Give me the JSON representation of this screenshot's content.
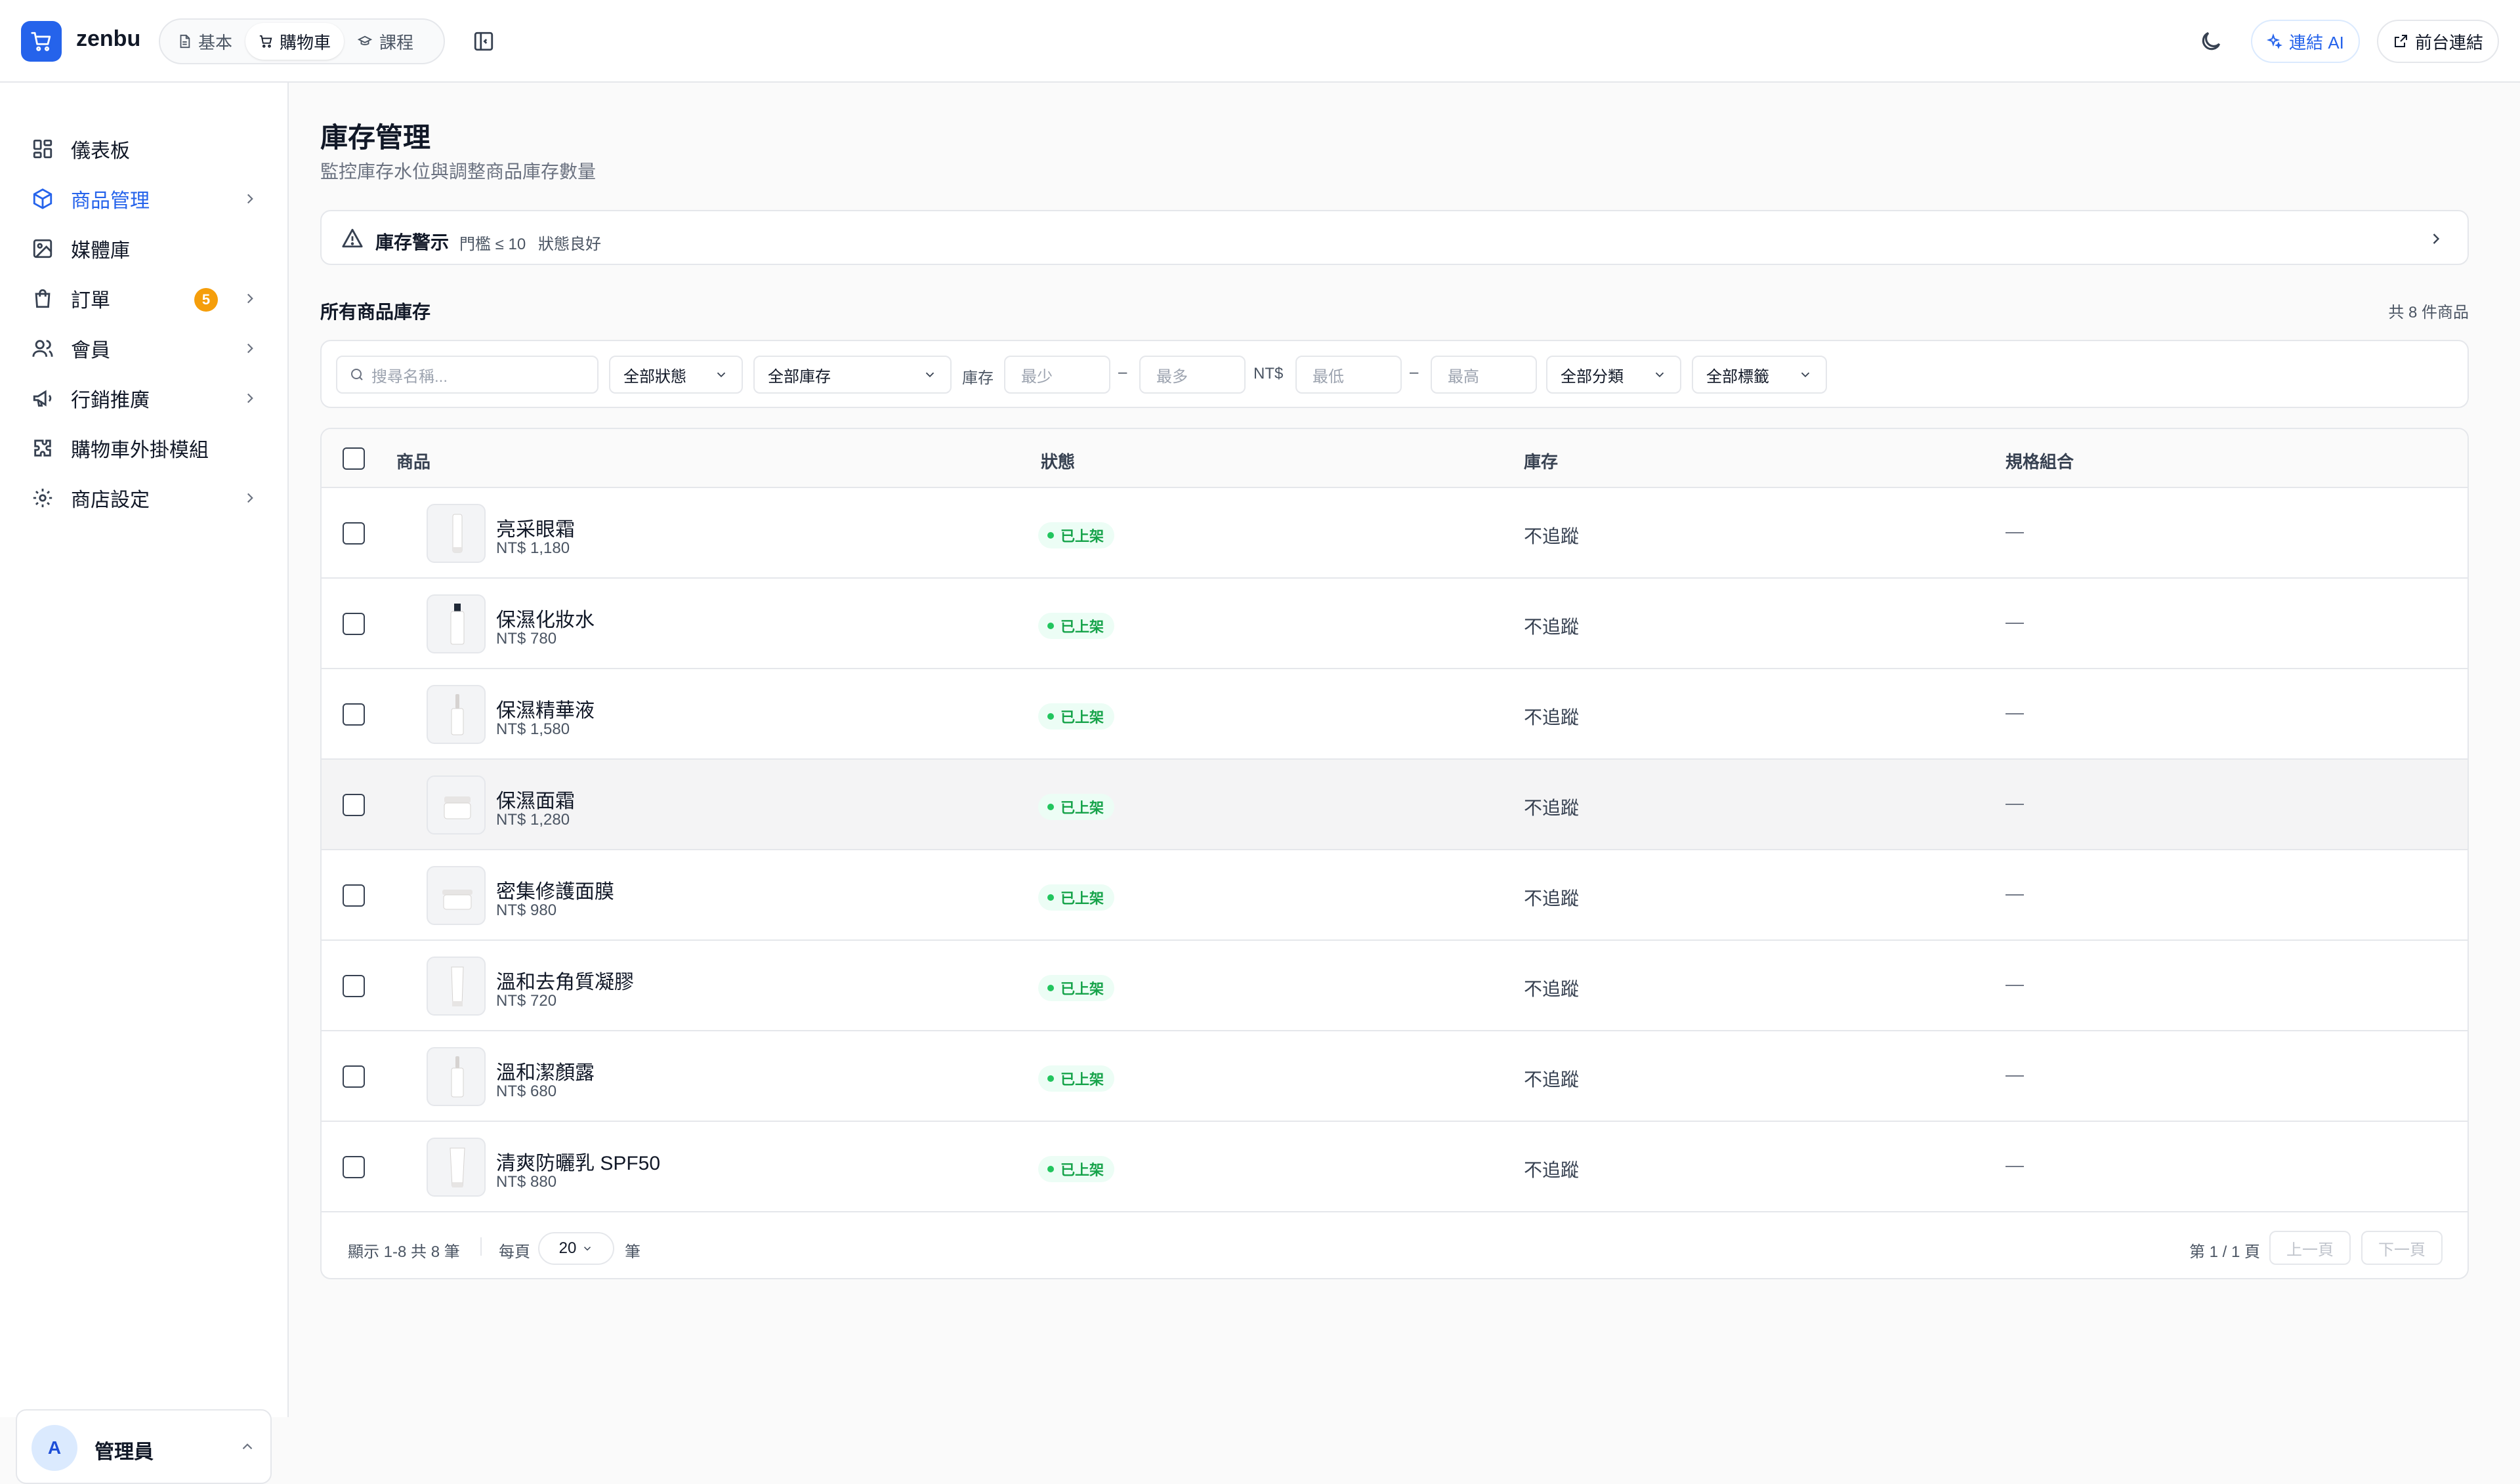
{
  "brand": {
    "name": "zenbu"
  },
  "mode_tabs": [
    {
      "label": "基本",
      "icon": "document-icon"
    },
    {
      "label": "購物車",
      "icon": "cart-icon"
    },
    {
      "label": "課程",
      "icon": "graduation-cap-icon"
    }
  ],
  "header_actions": {
    "connect_ai": "連結 AI",
    "storefront": "前台連結"
  },
  "sidebar": {
    "items": [
      {
        "label": "儀表板",
        "icon": "dashboard-icon"
      },
      {
        "label": "商品管理",
        "icon": "box-icon"
      },
      {
        "label": "媒體庫",
        "icon": "image-icon"
      },
      {
        "label": "訂單",
        "icon": "bag-icon",
        "badge": "5"
      },
      {
        "label": "會員",
        "icon": "users-icon"
      },
      {
        "label": "行銷推廣",
        "icon": "megaphone-icon"
      },
      {
        "label": "購物車外掛模組",
        "icon": "puzzle-icon"
      },
      {
        "label": "商店設定",
        "icon": "settings-icon"
      }
    ]
  },
  "user": {
    "initial": "A",
    "name": "管理員"
  },
  "page": {
    "title": "庫存管理",
    "subtitle": "監控庫存水位與調整商品庫存數量"
  },
  "alert": {
    "title": "庫存警示",
    "threshold": "門檻 ≤ 10",
    "status": "狀態良好"
  },
  "section": {
    "title": "所有商品庫存",
    "count": "共 8 件商品"
  },
  "filters": {
    "search_placeholder": "搜尋名稱...",
    "status": "全部狀態",
    "stock": "全部庫存",
    "stock_label": "庫存",
    "stock_min": "最少",
    "stock_max": "最多",
    "price_label": "NT$",
    "price_min": "最低",
    "price_max": "最高",
    "category": "全部分類",
    "tag": "全部標籤",
    "dash": "–"
  },
  "table": {
    "headers": {
      "product": "商品",
      "status": "狀態",
      "stock": "庫存",
      "variants": "規格組合"
    },
    "rows": [
      {
        "name": "亮采眼霜",
        "price": "NT$ 1,180",
        "status": "已上架",
        "stock": "不追蹤",
        "variants": "—"
      },
      {
        "name": "保濕化妝水",
        "price": "NT$ 780",
        "status": "已上架",
        "stock": "不追蹤",
        "variants": "—"
      },
      {
        "name": "保濕精華液",
        "price": "NT$ 1,580",
        "status": "已上架",
        "stock": "不追蹤",
        "variants": "—"
      },
      {
        "name": "保濕面霜",
        "price": "NT$ 1,280",
        "status": "已上架",
        "stock": "不追蹤",
        "variants": "—"
      },
      {
        "name": "密集修護面膜",
        "price": "NT$ 980",
        "status": "已上架",
        "stock": "不追蹤",
        "variants": "—"
      },
      {
        "name": "溫和去角質凝膠",
        "price": "NT$ 720",
        "status": "已上架",
        "stock": "不追蹤",
        "variants": "—"
      },
      {
        "name": "溫和潔顏露",
        "price": "NT$ 680",
        "status": "已上架",
        "stock": "不追蹤",
        "variants": "—"
      },
      {
        "name": "清爽防曬乳 SPF50",
        "price": "NT$ 880",
        "status": "已上架",
        "stock": "不追蹤",
        "variants": "—"
      }
    ]
  },
  "footer": {
    "showing": "顯示 1-8 共 8 筆",
    "per_page_label": "每頁",
    "per_page_value": "20",
    "per_page_unit": "筆",
    "page_info": "第 1 / 1 頁",
    "prev": "上一頁",
    "next": "下一頁"
  },
  "colors": {
    "accent": "#2563eb",
    "badge": "#f59e0b",
    "success": "#16a34a",
    "border": "#e5e7eb"
  }
}
